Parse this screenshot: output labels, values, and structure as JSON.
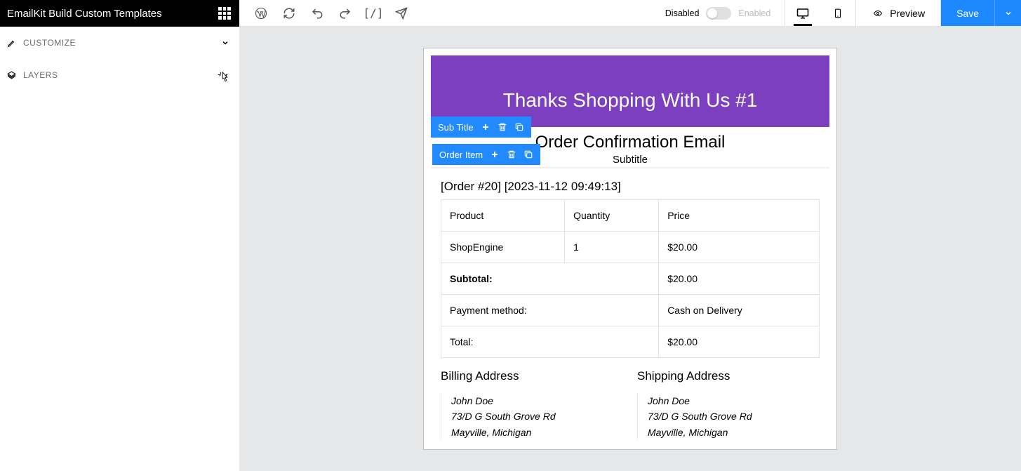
{
  "sidebar": {
    "title": "EmailKit Build Custom Templates",
    "panels": [
      {
        "label": "CUSTOMIZE"
      },
      {
        "label": "LAYERS"
      }
    ]
  },
  "topbar": {
    "toggle": {
      "disabled_label": "Disabled",
      "enabled_label": "Enabled"
    },
    "preview_label": "Preview",
    "save_label": "Save"
  },
  "widget_tags": {
    "subtitle": "Sub Title",
    "order_item": "Order Item"
  },
  "email": {
    "hero_title": "Thanks Shopping With Us #1",
    "section_title": "Order Confirmation Email",
    "section_subtitle": "Subtitle",
    "order_meta": "[Order #20] [2023-11-12 09:49:13]",
    "table": {
      "headers": {
        "product": "Product",
        "quantity": "Quantity",
        "price": "Price"
      },
      "row": {
        "product": "ShopEngine",
        "quantity": "1",
        "price": "$20.00"
      },
      "subtotal_label": "Subtotal:",
      "subtotal_value": "$20.00",
      "payment_label": "Payment method:",
      "payment_value": "Cash on Delivery",
      "total_label": "Total:",
      "total_value": "$20.00"
    },
    "billing": {
      "title": "Billing Address",
      "name": "John Doe",
      "street": "73/D G South Grove Rd",
      "city": "Mayville, Michigan"
    },
    "shipping": {
      "title": "Shipping Address",
      "name": "John Doe",
      "street": "73/D G South Grove Rd",
      "city": "Mayville, Michigan"
    }
  }
}
